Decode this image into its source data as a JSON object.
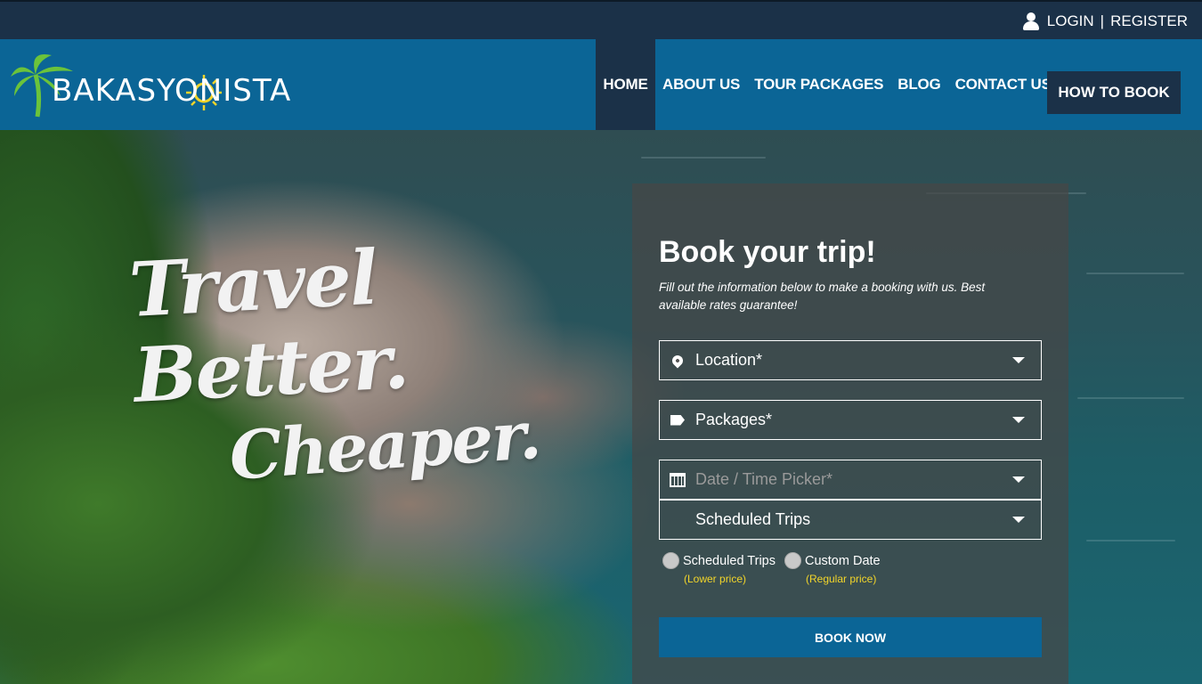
{
  "auth": {
    "login": "LOGIN",
    "separator": "|",
    "register": "REGISTER"
  },
  "brand": {
    "name": "BAKASYONISTA"
  },
  "nav": {
    "items": [
      "HOME",
      "ABOUT US",
      "TOUR PACKAGES",
      "BLOG",
      "CONTACT US"
    ],
    "cta": "HOW TO BOOK"
  },
  "hero": {
    "line1": "Travel Better.",
    "line2": "Cheaper."
  },
  "booking": {
    "title": "Book your trip!",
    "subtitle": "Fill out the information below to make a booking with us. Best available rates guarantee!",
    "location": "Location*",
    "packages": "Packages*",
    "date_placeholder": "Date / Time Picker*",
    "schedule": "Scheduled Trips",
    "options": [
      {
        "label": "Scheduled Trips",
        "note": "(Lower price)"
      },
      {
        "label": "Custom Date",
        "note": "(Regular price)"
      }
    ],
    "submit": "BOOK NOW"
  },
  "colors": {
    "primary": "#0b6596",
    "dark": "#1b3148",
    "highlight": "#f2d52a",
    "logo_green": "#6bc33b",
    "logo_sun": "#f2d52a"
  },
  "icons": [
    "user-icon",
    "palm-tree-icon",
    "sun-icon",
    "location-pin-icon",
    "tag-icon",
    "calendar-icon",
    "chevron-down-icon"
  ]
}
